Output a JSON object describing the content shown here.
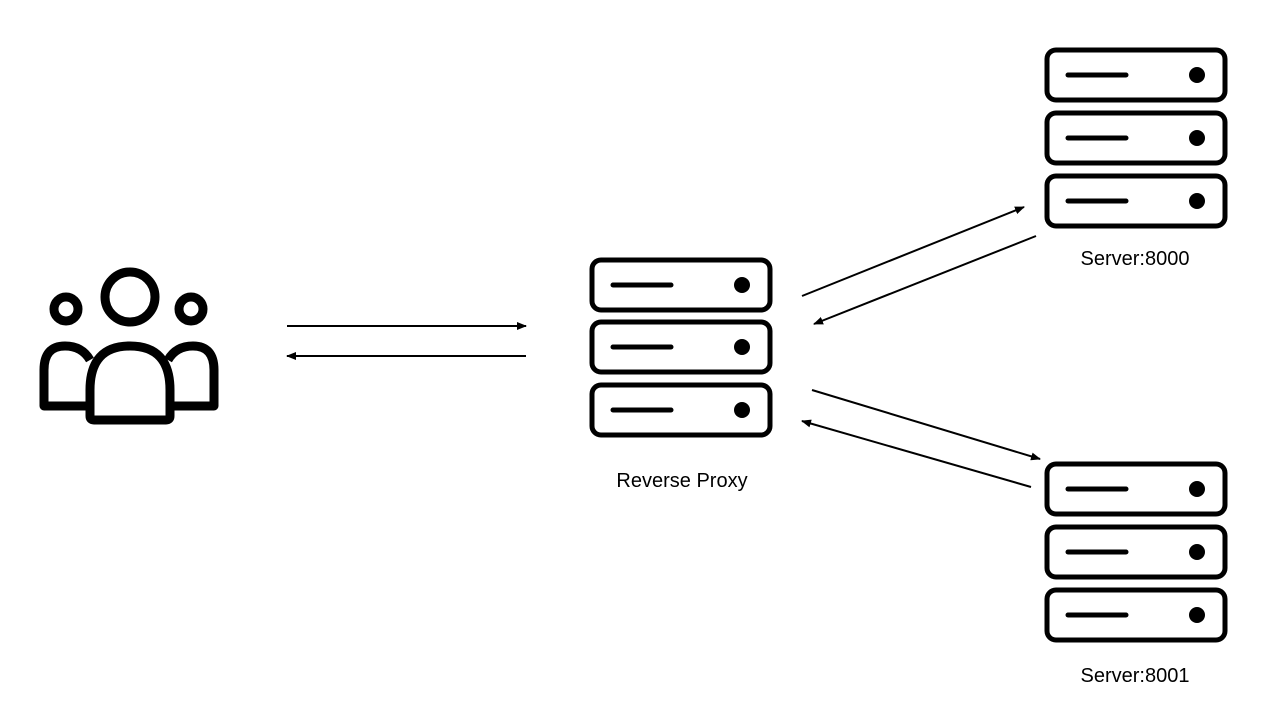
{
  "diagram": {
    "nodes": {
      "clients": {
        "icon": "users-icon"
      },
      "proxy": {
        "label": "Reverse Proxy",
        "icon": "server-stack-icon"
      },
      "server_a": {
        "label": "Server:8000",
        "icon": "server-stack-icon"
      },
      "server_b": {
        "label": "Server:8001",
        "icon": "server-stack-icon"
      }
    },
    "edges": [
      {
        "from": "clients",
        "to": "proxy"
      },
      {
        "from": "proxy",
        "to": "clients"
      },
      {
        "from": "proxy",
        "to": "server_a"
      },
      {
        "from": "server_a",
        "to": "proxy"
      },
      {
        "from": "proxy",
        "to": "server_b"
      },
      {
        "from": "server_b",
        "to": "proxy"
      }
    ],
    "colors": {
      "stroke": "#000000",
      "background": "#ffffff"
    }
  }
}
